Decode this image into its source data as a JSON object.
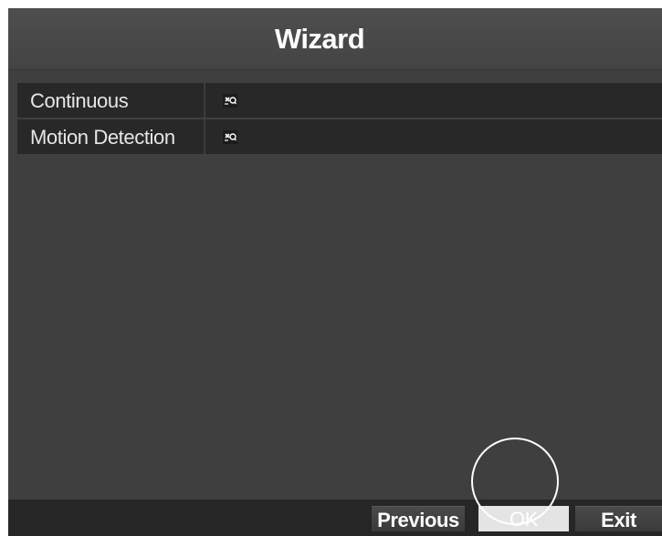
{
  "dialog": {
    "title": "Wizard"
  },
  "schedule_rows": [
    {
      "label": "Continuous",
      "edit_icon": "edit-schedule-icon"
    },
    {
      "label": "Motion Detection",
      "edit_icon": "edit-schedule-icon"
    }
  ],
  "footer": {
    "previous_label": "Previous",
    "ok_label": "OK",
    "exit_label": "Exit"
  },
  "colors": {
    "dialog_background": "#3f3f3f",
    "title_bar": "#4e4e4e",
    "row_background": "#282828",
    "footer_background": "#262626",
    "highlight_button": "#e4e4e4",
    "text": "#ffffff"
  }
}
